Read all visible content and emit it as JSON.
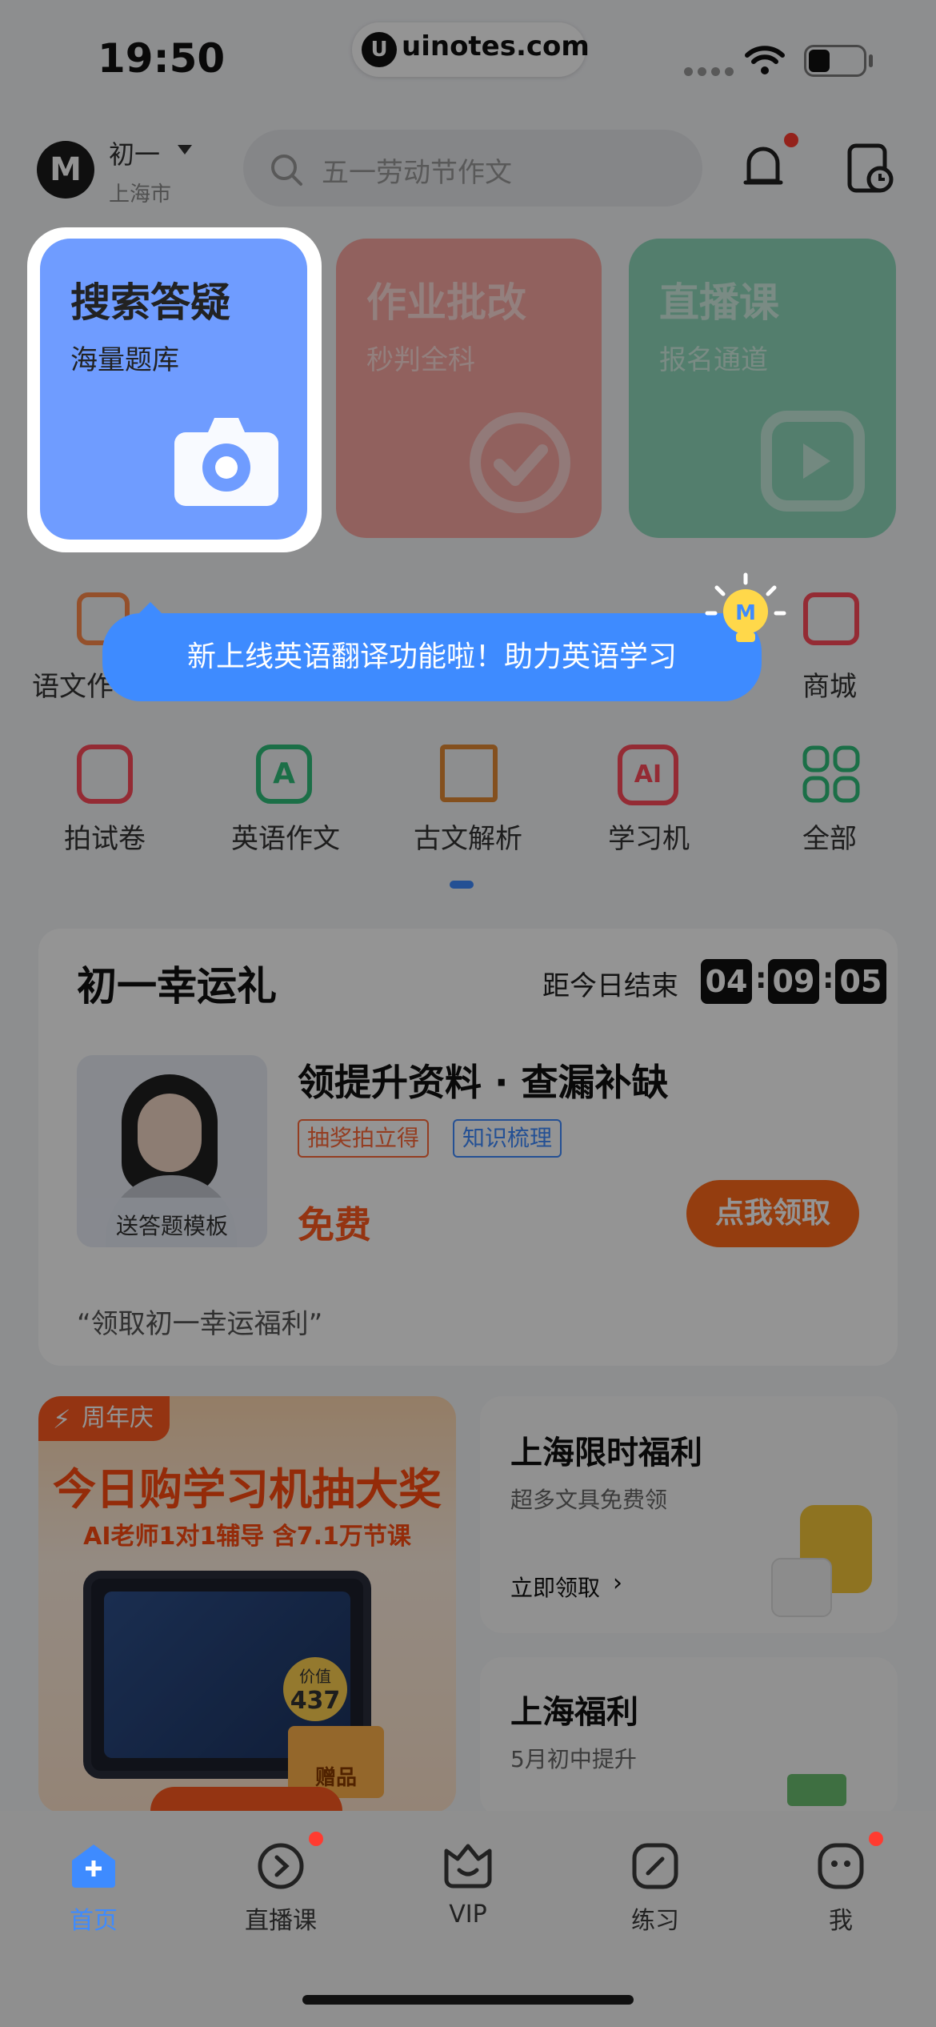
{
  "status": {
    "time": "19:50",
    "watermark": "uinotes.com",
    "watermark_logo": "U"
  },
  "header": {
    "avatar_letter": "M",
    "grade": "初一",
    "city": "上海市",
    "search_placeholder": "五一劳动节作文"
  },
  "cards": [
    {
      "title": "搜索答疑",
      "sub": "海量题库",
      "color": "#6f9cff"
    },
    {
      "title": "作业批改",
      "sub": "秒判全科",
      "color": "#ff6a5e"
    },
    {
      "title": "直播课",
      "sub": "报名通道",
      "color": "#3dc48d"
    }
  ],
  "grid_row1": [
    "语文作",
    "商城"
  ],
  "grid_row2": [
    "拍试卷",
    "英语作文",
    "古文解析",
    "学习机",
    "全部"
  ],
  "toast": "新上线英语翻译功能啦！助力英语学习",
  "lucky": {
    "title": "初一幸运礼",
    "countdown_label": "距今日结束",
    "hh": "04",
    "mm": "09",
    "ss": "05",
    "colon": ":",
    "item_title": "领提升资料 · 查漏补缺",
    "tag1": "抽奖拍立得",
    "tag2": "知识梳理",
    "price": "免费",
    "cta": "点我领取",
    "thumb_caption": "送答题模板",
    "quote": "“领取初一幸运福利”"
  },
  "promo": {
    "badge": "周年庆",
    "headline": "今日购学习机抽大奖",
    "subline": "AI老师1对1辅导 含7.1万节课",
    "price_tag_label": "价值",
    "price_tag_value": "437",
    "gift_label": "赠品",
    "card1_title": "上海限时福利",
    "card1_sub": "超多文具免费领",
    "card1_link": "立即领取",
    "card2_title": "上海福利",
    "card2_sub": "5月初中提升"
  },
  "tabs": [
    {
      "label": "首页",
      "active": true
    },
    {
      "label": "直播课",
      "dot": true
    },
    {
      "label": "VIP"
    },
    {
      "label": "练习"
    },
    {
      "label": "我",
      "dot": true
    }
  ],
  "colors": {
    "accent": "#3e8bff",
    "orange": "#ff6a1a",
    "red_dot": "#ff3b30"
  }
}
